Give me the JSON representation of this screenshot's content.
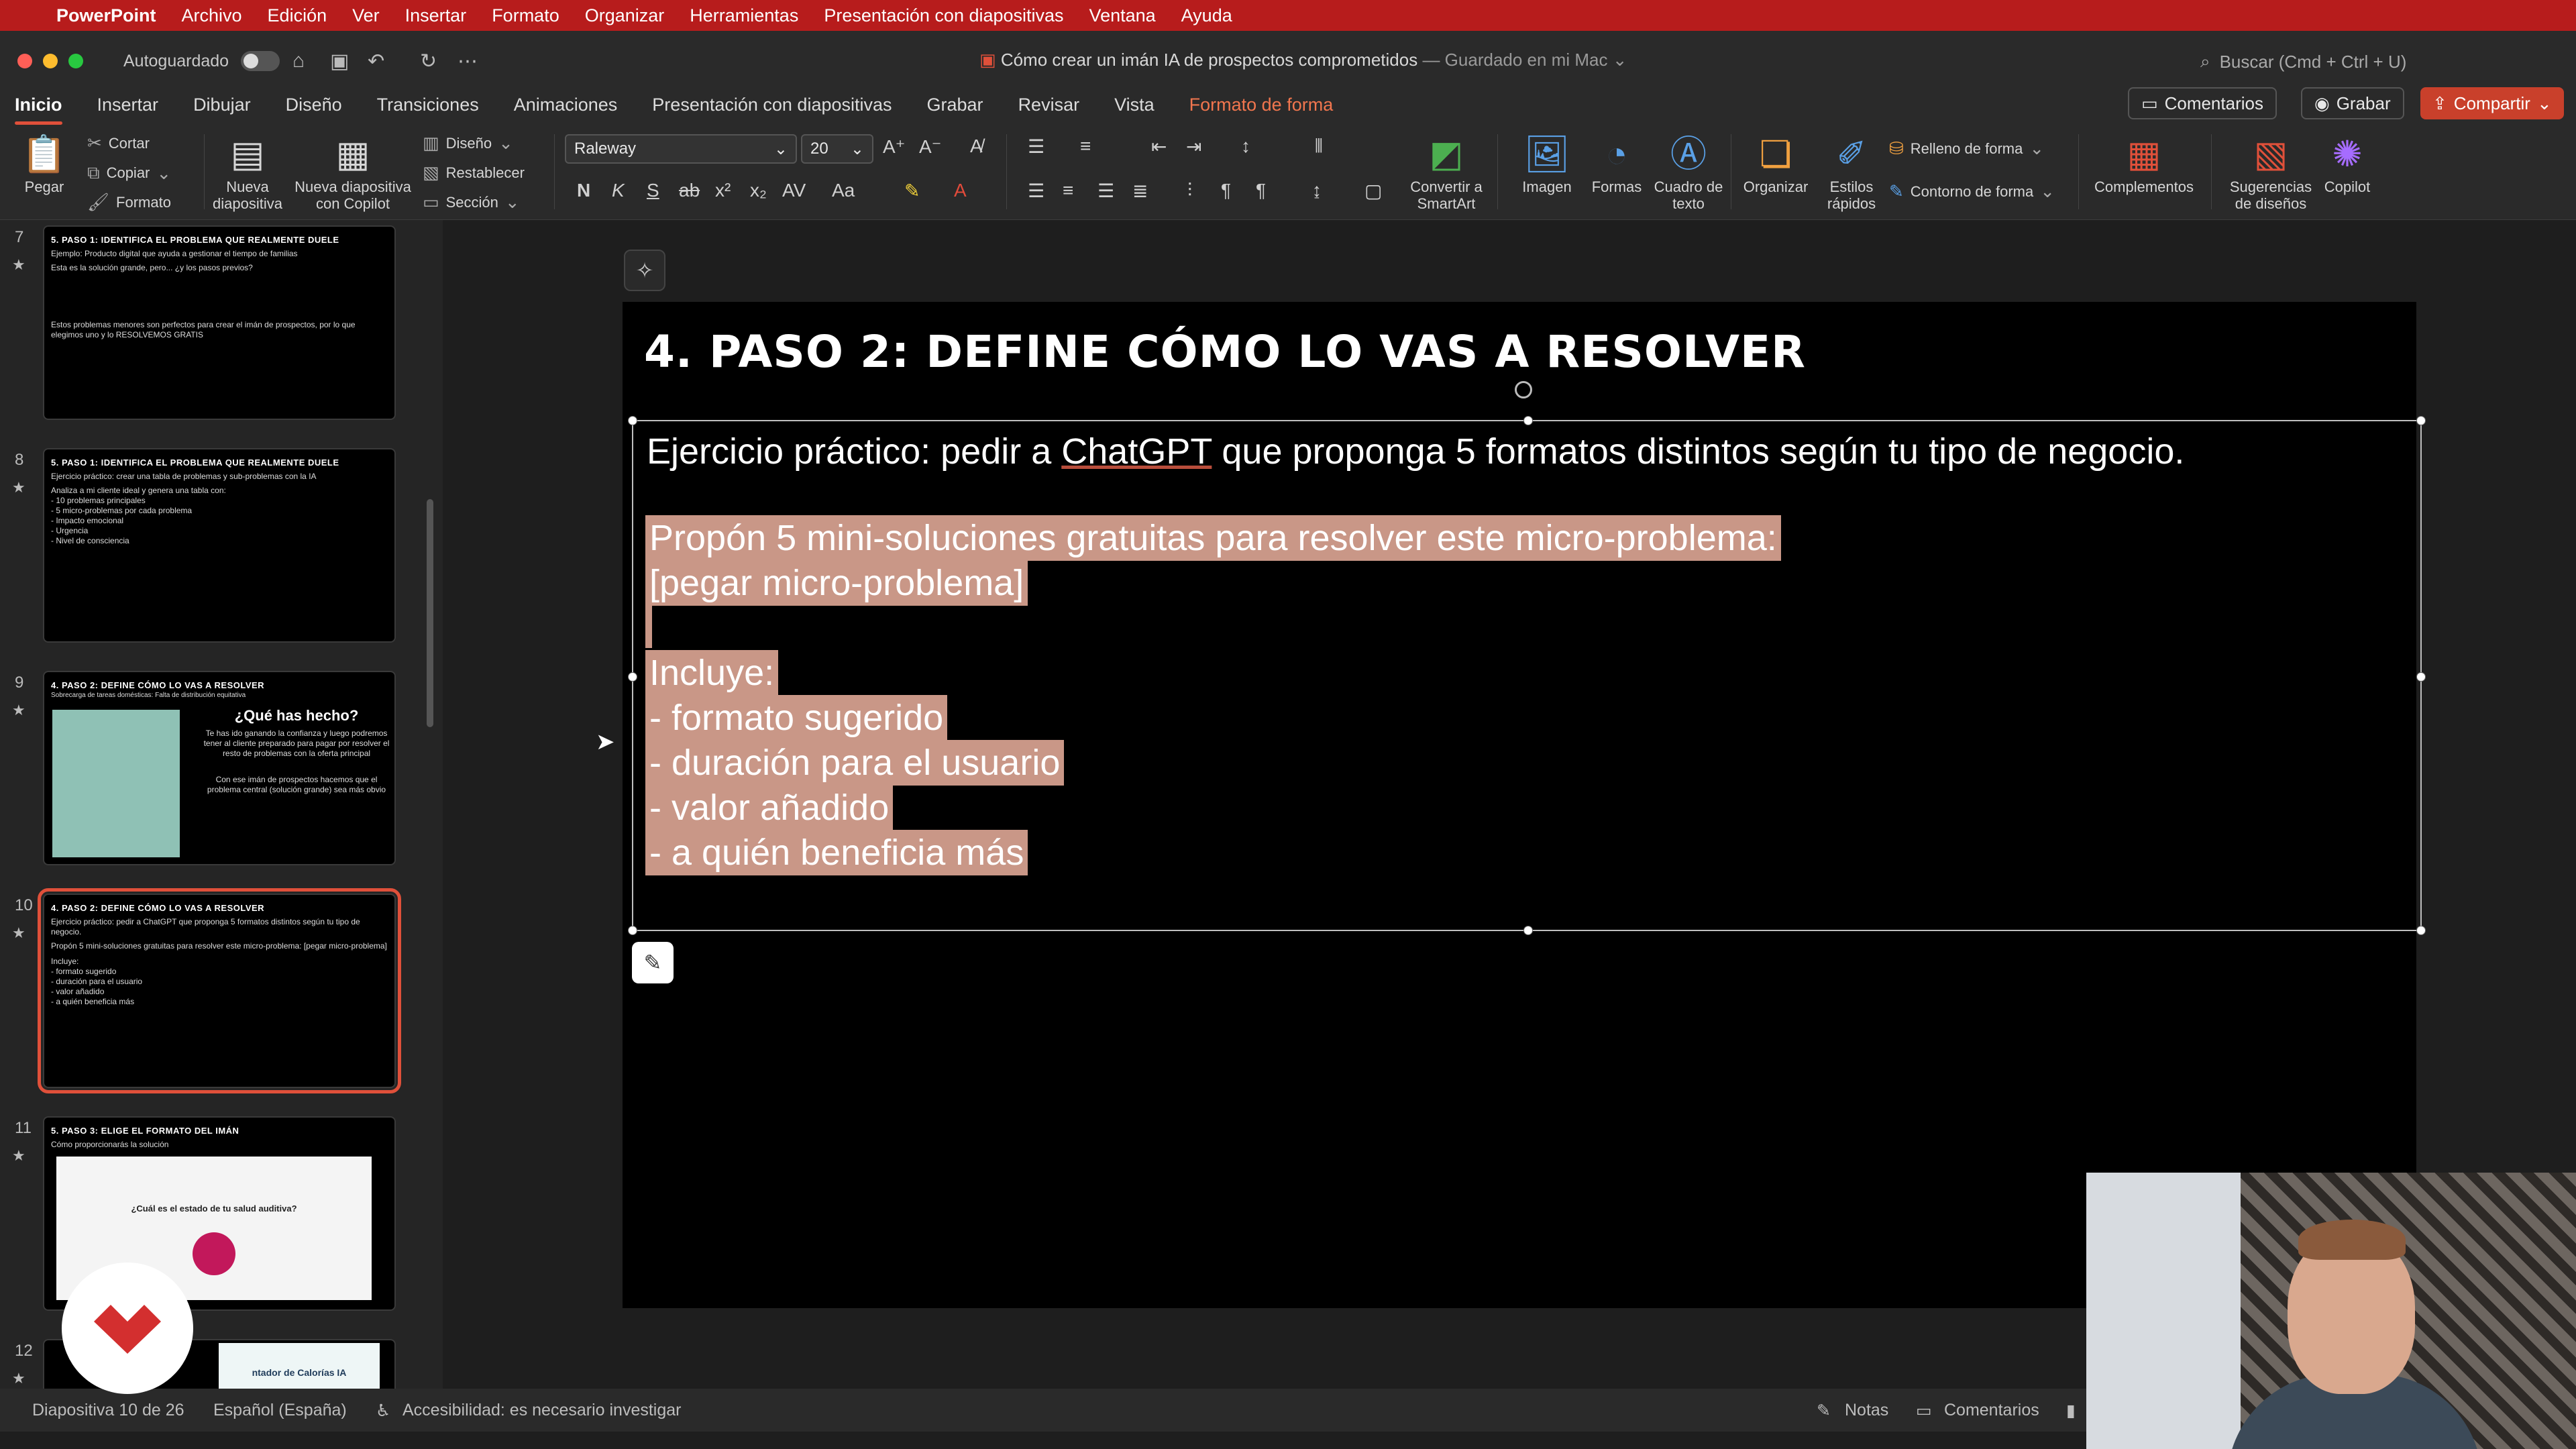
{
  "menubar": {
    "app": "PowerPoint",
    "items": [
      "Archivo",
      "Edición",
      "Ver",
      "Insertar",
      "Formato",
      "Organizar",
      "Herramientas",
      "Presentación con diapositivas",
      "Ventana",
      "Ayuda"
    ]
  },
  "titlebar": {
    "autosave": "Autoguardado",
    "doc_title": "Cómo crear un imán IA de prospectos comprometidos",
    "saved_status": "— Guardado en mi Mac",
    "search_placeholder": "Buscar (Cmd + Ctrl + U)"
  },
  "ribbon_tabs": [
    "Inicio",
    "Insertar",
    "Dibujar",
    "Diseño",
    "Transiciones",
    "Animaciones",
    "Presentación con diapositivas",
    "Grabar",
    "Revisar",
    "Vista",
    "Formato de forma"
  ],
  "ribbon_actions": {
    "comments": "Comentarios",
    "record": "Grabar",
    "share": "Compartir"
  },
  "ribbon": {
    "paste": "Pegar",
    "cut": "Cortar",
    "copy": "Copiar",
    "format": "Formato",
    "new_slide": "Nueva diapositiva",
    "new_slide_copilot": "Nueva diapositiva con Copilot",
    "layout": "Diseño",
    "reset": "Restablecer",
    "section": "Sección",
    "font": "Raleway",
    "font_size": "20",
    "convert_smartart": "Convertir a SmartArt",
    "image": "Imagen",
    "shapes": "Formas",
    "textbox": "Cuadro de texto",
    "arrange": "Organizar",
    "quick_styles": "Estilos rápidos",
    "shape_fill": "Relleno de forma",
    "shape_outline": "Contorno de forma",
    "addins": "Complementos",
    "design_ideas": "Sugerencias de diseños",
    "copilot": "Copilot",
    "bold": "N",
    "italic": "K",
    "underline": "S",
    "strike": "ab"
  },
  "thumbnails": [
    {
      "num": "7",
      "title": "5. PASO 1: IDENTIFICA EL PROBLEMA QUE REALMENTE DUELE",
      "lines": [
        "Ejemplo: Producto digital que ayuda a gestionar el tiempo de familias",
        "Esta es la solución grande, pero... ¿y los pasos previos?",
        "Estos problemas menores son perfectos para crear el imán de prospectos, por lo que elegimos uno y lo RESOLVEMOS GRATIS"
      ]
    },
    {
      "num": "8",
      "title": "5. PASO 1: IDENTIFICA EL PROBLEMA QUE REALMENTE DUELE",
      "lines": [
        "Ejercicio práctico: crear una tabla de problemas y sub-problemas con la IA",
        "Analiza a mi cliente ideal y genera una tabla con:",
        "- 10 problemas principales",
        "- 5 micro-problemas por cada problema",
        "- Impacto emocional",
        "- Urgencia",
        "- Nivel de consciencia"
      ]
    },
    {
      "num": "9",
      "title": "4. PASO 2: DEFINE CÓMO LO VAS A RESOLVER",
      "lines": [
        "Sobrecarga de tareas domésticas: Falta de distribución equitativa",
        "¿Qué has hecho?",
        "Te has ido ganando la confianza y luego podremos tener al cliente preparado para pagar por resolver el resto de problemas con la oferta principal",
        "Con ese imán de prospectos hacemos que el problema central (solución grande) sea más obvio"
      ]
    },
    {
      "num": "10",
      "title": "4. PASO 2: DEFINE CÓMO LO VAS A RESOLVER",
      "lines": [
        "Ejercicio práctico: pedir a ChatGPT que proponga 5 formatos distintos según tu tipo de negocio.",
        "Propón 5 mini-soluciones gratuitas para resolver este micro-problema: [pegar micro-problema]",
        "Incluye:",
        "- formato sugerido",
        "- duración para el usuario",
        "- valor añadido",
        "- a quién beneficia más"
      ]
    },
    {
      "num": "11",
      "title": "5. PASO 3: ELIGE EL FORMATO DEL IMÁN",
      "lines": [
        "Cómo proporcionarás la solución",
        "¿Cuál es el estado de tu salud auditiva?"
      ]
    },
    {
      "num": "12",
      "title": "",
      "lines": [
        "ntador de Calorías IA"
      ]
    }
  ],
  "slide": {
    "title": "4. PASO 2: DEFINE CÓMO LO VAS A RESOLVER",
    "line1_pre": "Ejercicio práctico: pedir a ",
    "line1_link": "ChatGPT",
    "line1_post": " que proponga 5 formatos distintos según tu tipo de negocio.",
    "prompt_lines": [
      "Propón 5 mini-soluciones gratuitas para resolver este micro-problema:",
      "[pegar micro-problema]",
      "",
      "Incluye:",
      "- formato sugerido",
      "- duración para el usuario",
      "- valor añadido",
      "- a quién beneficia más"
    ]
  },
  "statusbar": {
    "slide_counter": "Diapositiva 10 de 26",
    "language": "Español (España)",
    "accessibility": "Accesibilidad: es necesario investigar",
    "notes": "Notas",
    "comments": "Comentarios"
  },
  "colors": {
    "menubar": "#b71c1c",
    "accent": "#e0503a",
    "highlight": "#c99787",
    "share": "#c9402b"
  }
}
